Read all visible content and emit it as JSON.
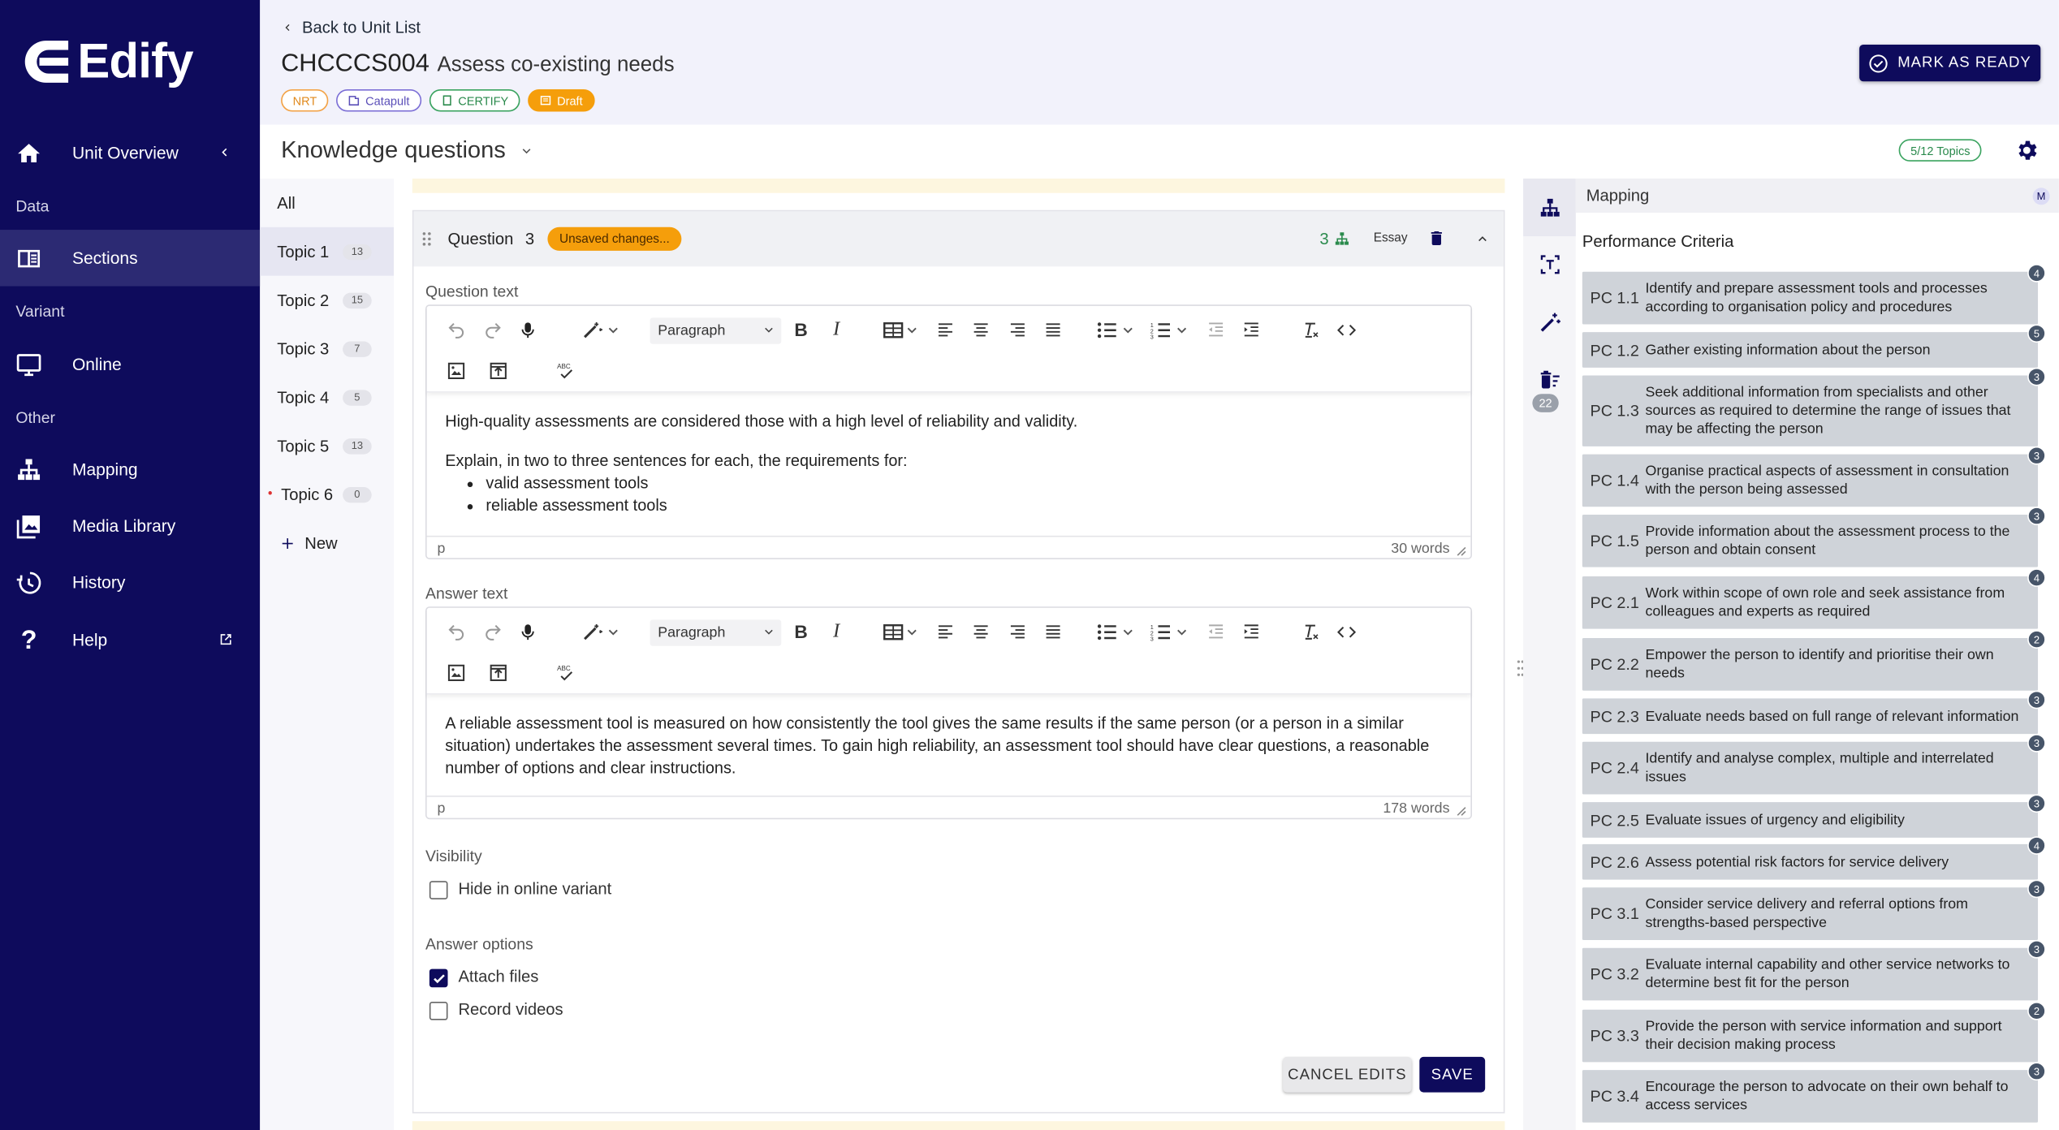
{
  "app": {
    "name": "Edify"
  },
  "sidebar": {
    "items": [
      {
        "label": "Unit Overview"
      },
      {
        "label": "Sections"
      },
      {
        "label": "Online"
      },
      {
        "label": "Mapping"
      },
      {
        "label": "Media Library"
      },
      {
        "label": "History"
      },
      {
        "label": "Help"
      }
    ],
    "sections": [
      "Data",
      "Variant",
      "Other"
    ]
  },
  "header": {
    "back_label": "Back to Unit List",
    "unit_code": "CHCCCS004",
    "unit_name": "Assess co-existing needs",
    "badges": [
      "NRT",
      "Catapult",
      "CERTIFY",
      "Draft"
    ],
    "mark_ready_label": "MARK AS READY"
  },
  "section": {
    "title": "Knowledge questions",
    "topics_count": "5/12 Topics"
  },
  "topics": [
    {
      "label": "All",
      "count": ""
    },
    {
      "label": "Topic 1",
      "count": "13"
    },
    {
      "label": "Topic 2",
      "count": "15"
    },
    {
      "label": "Topic 3",
      "count": "7"
    },
    {
      "label": "Topic 4",
      "count": "5"
    },
    {
      "label": "Topic 5",
      "count": "13"
    },
    {
      "label": "Topic 6",
      "count": "0"
    }
  ],
  "new_topic_label": "New",
  "question": {
    "label": "Question",
    "number": "3",
    "status": "Unsaved changes...",
    "mapping_count": "3",
    "type": "Essay",
    "question_text_label": "Question text",
    "answer_text_label": "Answer text",
    "paragraph_format": "Paragraph",
    "question_body": {
      "p1": "High-quality assessments are considered those with a high level of reliability and validity.",
      "p2": "Explain, in two to three sentences for each, the requirements for:",
      "bullets": [
        "valid assessment tools",
        "reliable assessment tools"
      ]
    },
    "question_status": {
      "tag": "p",
      "words": "30 words"
    },
    "answer_body": "A reliable assessment tool is measured on how consistently the tool gives the same results if the same person (or a person in a similar situation) undertakes the assessment several times. To gain high reliability, an assessment tool should have clear questions, a reasonable number of options and clear instructions.",
    "answer_status": {
      "tag": "p",
      "words": "178 words"
    },
    "visibility_label": "Visibility",
    "hide_online_label": "Hide in online variant",
    "answer_options_label": "Answer options",
    "attach_files_label": "Attach files",
    "record_videos_label": "Record videos",
    "attach_files_checked": true,
    "record_videos_checked": false,
    "hide_online_checked": false,
    "cancel_label": "CANCEL EDITS",
    "save_label": "SAVE"
  },
  "right_panel": {
    "title": "Mapping",
    "user_initial": "M",
    "side_badge": "22",
    "subtitle": "Performance Criteria",
    "criteria": [
      {
        "code": "PC 1.1",
        "text": "Identify and prepare assessment tools and processes according to organisation policy and procedures",
        "count": "4"
      },
      {
        "code": "PC 1.2",
        "text": "Gather existing information about the person",
        "count": "5"
      },
      {
        "code": "PC 1.3",
        "text": "Seek additional information from specialists and other sources as required to determine the range of issues that may be affecting the person",
        "count": "3"
      },
      {
        "code": "PC 1.4",
        "text": "Organise practical aspects of assessment in consultation with the person being assessed",
        "count": "3"
      },
      {
        "code": "PC 1.5",
        "text": "Provide information about the assessment process to the person and obtain consent",
        "count": "3"
      },
      {
        "code": "PC 2.1",
        "text": "Work within scope of own role and seek assistance from colleagues and experts as required",
        "count": "4"
      },
      {
        "code": "PC 2.2",
        "text": "Empower the person to identify and prioritise their own needs",
        "count": "2"
      },
      {
        "code": "PC 2.3",
        "text": "Evaluate needs based on full range of relevant information",
        "count": "3"
      },
      {
        "code": "PC 2.4",
        "text": "Identify and analyse complex, multiple and interrelated issues",
        "count": "3"
      },
      {
        "code": "PC 2.5",
        "text": "Evaluate issues of urgency and eligibility",
        "count": "3"
      },
      {
        "code": "PC 2.6",
        "text": "Assess potential risk factors for service delivery",
        "count": "4"
      },
      {
        "code": "PC 3.1",
        "text": "Consider service delivery and referral options from strengths-based perspective",
        "count": "3"
      },
      {
        "code": "PC 3.2",
        "text": "Evaluate internal capability and other service networks to determine best fit for the person",
        "count": "3"
      },
      {
        "code": "PC 3.3",
        "text": "Provide the person with service information and support their decision making process",
        "count": "2"
      },
      {
        "code": "PC 3.4",
        "text": "Encourage the person to advocate on their own behalf to access services",
        "count": "3"
      }
    ]
  },
  "colors": {
    "brand": "#0e0b5c",
    "accent": "#f59e0b",
    "success": "#2a8a4c"
  }
}
